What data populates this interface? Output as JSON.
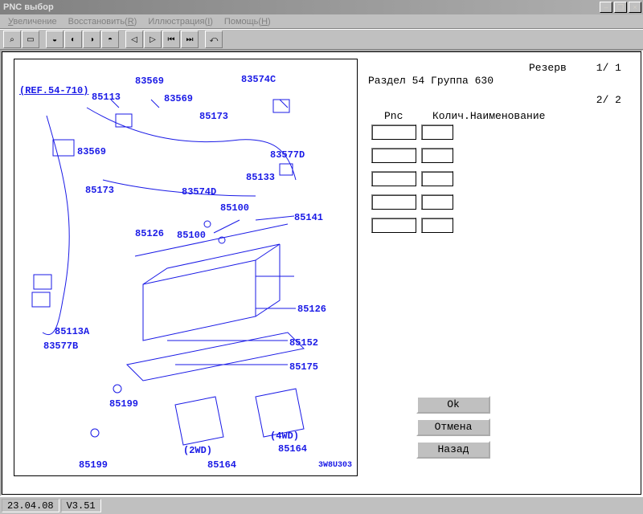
{
  "window": {
    "title": "PNC выбор"
  },
  "menu": [
    {
      "pre": "",
      "hot": "У",
      "post": "величение"
    },
    {
      "pre": "Восстановить(",
      "hot": "R",
      "post": ")"
    },
    {
      "pre": "Иллюстрация(",
      "hot": "I",
      "post": ")"
    },
    {
      "pre": "Помощь(",
      "hot": "H",
      "post": ")"
    }
  ],
  "toolbar_icons": [
    "⌕",
    "▭",
    "◒",
    "◐",
    "◑",
    "◓",
    "",
    "◁",
    "▷",
    "⏮",
    "⏭",
    "",
    "⤺"
  ],
  "header": {
    "reserve": "Резерв",
    "page1": "1/ 1",
    "section": "Раздел 54 Группа 630",
    "page2": "2/ 2"
  },
  "columns": {
    "pnc": "Pnc",
    "qty": "Колич.",
    "name": "Наименование"
  },
  "rows": [
    {
      "pnc": "",
      "qty": ""
    },
    {
      "pnc": "",
      "qty": ""
    },
    {
      "pnc": "",
      "qty": ""
    },
    {
      "pnc": "",
      "qty": ""
    },
    {
      "pnc": "",
      "qty": ""
    }
  ],
  "buttons": {
    "ok": "Ok",
    "cancel": "Отмена",
    "back": "Назад"
  },
  "status": {
    "date": "23.04.08",
    "version": "V3.51"
  },
  "diagram": {
    "ref": "(REF.54-710)",
    "labels": {
      "l83569a": "83569",
      "l85113": "85113",
      "l83569b": "83569",
      "l83574c": "83574C",
      "l85173a": "85173",
      "l83569c": "83569",
      "l83577d": "83577D",
      "l85173b": "85173",
      "l85133": "85133",
      "l83574d": "83574D",
      "l85100a": "85100",
      "l85126a": "85126",
      "l85100b": "85100",
      "l85141": "85141",
      "l85126b": "85126",
      "l85113a": "85113A",
      "l83577b": "83577B",
      "l85152": "85152",
      "l85175": "85175",
      "l85199a": "85199",
      "l2wd": "(2WD)",
      "l4wd": "(4WD)",
      "l85164a": "85164",
      "l85199b": "85199",
      "l85164b": "85164",
      "lcode": "3W8U303"
    }
  }
}
